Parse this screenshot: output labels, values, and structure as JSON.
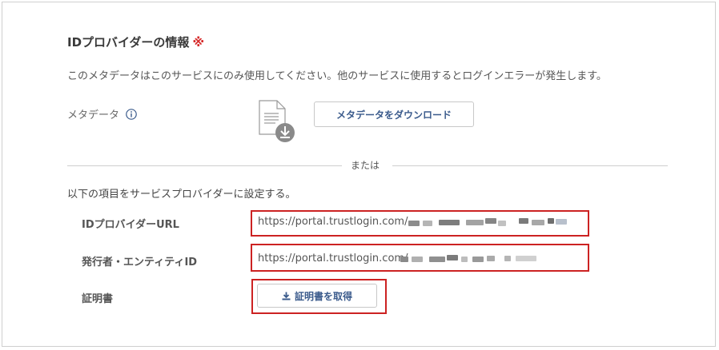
{
  "section": {
    "title": "IDプロバイダーの情報",
    "required_mark": "※",
    "notice": "このメタデータはこのサービスにのみ使用してください。他のサービスに使用するとログインエラーが発生します。"
  },
  "metadata": {
    "label": "メタデータ",
    "download_button": "メタデータをダウンロード"
  },
  "divider": {
    "text": "または"
  },
  "instruction": "以下の項目をサービスプロバイダーに設定する。",
  "fields": {
    "idp_url": {
      "label": "IDプロバイダーURL",
      "value": "https://portal.trustlogin.com/"
    },
    "issuer": {
      "label": "発行者・エンティティID",
      "value": "https://portal.trustlogin.com/"
    },
    "certificate": {
      "label": "証明書",
      "button": "証明書を取得"
    }
  },
  "colors": {
    "highlight": "#cc2222",
    "button_text": "#3b5b8c",
    "required_mark": "#d62b2b"
  }
}
